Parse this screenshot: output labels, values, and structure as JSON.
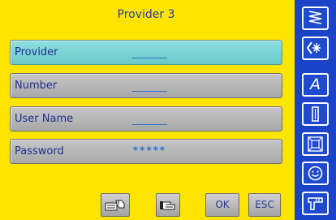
{
  "header": {
    "title": "Provider 3"
  },
  "fields": [
    {
      "label": "Provider",
      "value": "",
      "active": true
    },
    {
      "label": "Number",
      "value": ""
    },
    {
      "label": "User Name",
      "value": ""
    },
    {
      "label": "Password",
      "value": "*****"
    }
  ],
  "footer": {
    "ok_label": "OK",
    "esc_label": "ESC",
    "icons": [
      "keyboard-hand-icon",
      "hand-pointing-icon"
    ]
  },
  "sidebar": {
    "items": [
      {
        "icon": "zigzag-stitch-icon"
      },
      {
        "icon": "decorative-stitch-icon"
      },
      {
        "icon": "alphabet-icon",
        "glyph": "A"
      },
      {
        "icon": "buttonhole-icon"
      },
      {
        "icon": "quilt-icon"
      },
      {
        "icon": "smiley-icon"
      },
      {
        "icon": "setup-icon"
      }
    ]
  },
  "colors": {
    "background": "#ffe400",
    "active_field": "#7fd6d6",
    "field": "#b8b8b8",
    "sidebar": "#1a43c8",
    "text": "#1f2f8f"
  }
}
